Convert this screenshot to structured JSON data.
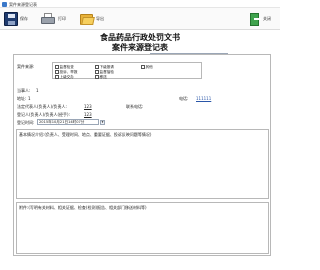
{
  "window": {
    "title": "案件来源登记表"
  },
  "toolbar": {
    "save_label": "保存",
    "print_label": "打印",
    "export_label": "导出",
    "exit_label": "关闭"
  },
  "document": {
    "title_line1": "食品药品行政处罚文书",
    "title_line2": "案件来源登记表"
  },
  "form": {
    "number_value": "(XX) 食药监   () 第(XXX)号",
    "source_label": "案件来源:",
    "source_options": [
      {
        "label": "监督检查"
      },
      {
        "label": "投诉、举报"
      },
      {
        "label": "上级交办"
      },
      {
        "label": "下级报请"
      },
      {
        "label": "监督抽验"
      },
      {
        "label": "移送"
      },
      {
        "label": "其他"
      }
    ],
    "party_label": "当事人:",
    "party_value": "1",
    "address_label": "地址:",
    "address_value": "1",
    "phone_label": "电话:",
    "phone_value": "111111",
    "legal_rep_label": "法定代表人(负责人)/负责人:",
    "legal_rep_value": "123",
    "contact_label": "联系电话:",
    "registrant_label": "登记人(负责人)/负责人(经手):",
    "registrant_value": "123",
    "date_label": "登记时间:",
    "date_value": "2015年10月21日14时07分",
    "content_label": "基本情况介绍:(负责人、受理时间、地点、重要证据、投诉反映问题等情况)",
    "opinion_label": "附件:(写明有关材料、相关证据、检查(检测)报告、相关部门移送材料等)"
  }
}
